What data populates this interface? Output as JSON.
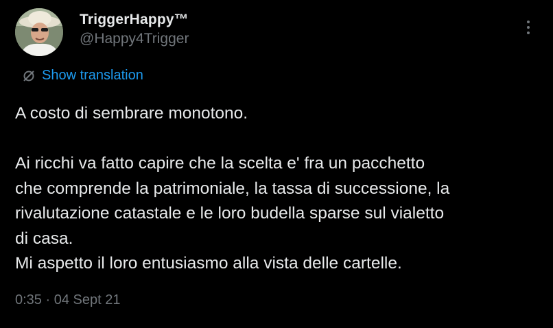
{
  "user": {
    "display_name": "TriggerHappy™",
    "handle": "@Happy4Trigger"
  },
  "translate": {
    "icon": "translate-icon",
    "label": "Show translation"
  },
  "tweet": {
    "text": "A costo di sembrare monotono.\n\nAi ricchi va fatto capire che la scelta e' fra un pacchetto\nche comprende la patrimoniale, la tassa di successione, la\nrivalutazione catastale e le loro budella sparse sul vialetto\ndi casa.\nMi aspetto il loro entusiasmo alla vista delle cartelle.",
    "timestamp": "0:35 · 04 Sept 21"
  },
  "colors": {
    "background": "#000000",
    "text": "#e7e9ea",
    "secondary": "#71767b",
    "accent": "#1d9bf0"
  },
  "icons": {
    "more": "more-options-icon",
    "avatar": "avatar"
  }
}
